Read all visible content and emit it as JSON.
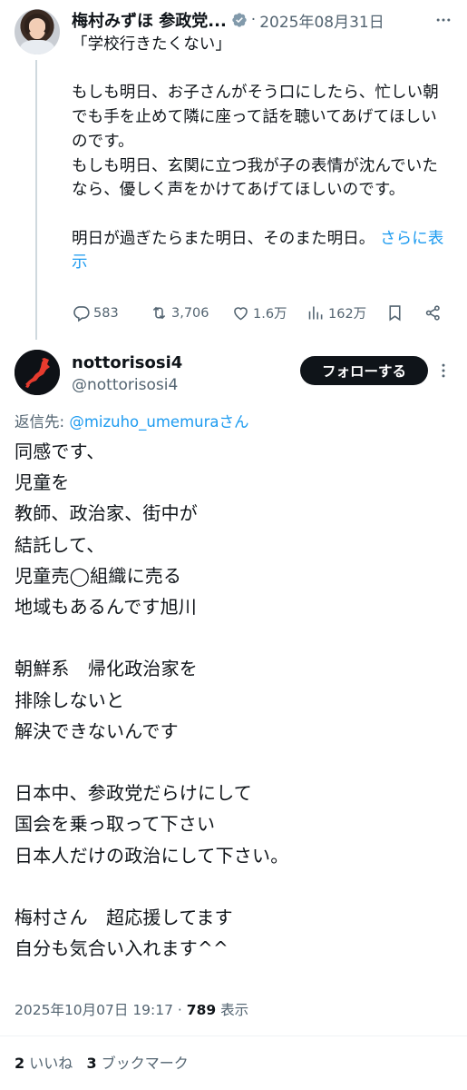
{
  "parent_tweet": {
    "author_name": "梅村みずほ 参政党...",
    "separator": "·",
    "date": "2025年08月31日",
    "text_main": "「学校行きたくない」\n\nもしも明日、お子さんがそう口にしたら、忙しい朝でも手を止めて隣に座って話を聴いてあげてほしいのです。\nもしも明日、玄関に立つ我が子の表情が沈んでいたなら、優しく声をかけてあげてほしいのです。\n\n明日が過ぎたらまた明日、そのまた明日。 ",
    "show_more": "さらに表示",
    "replies": "583",
    "reposts": "3,706",
    "likes": "1.6万",
    "views": "162万",
    "icons": [
      "verified-badge-icon",
      "more-icon",
      "reply-icon",
      "repost-icon",
      "like-icon",
      "views-icon",
      "bookmark-icon",
      "share-icon"
    ]
  },
  "reply_tweet": {
    "author_name": "nottorisosi4",
    "handle": "@nottorisosi4",
    "follow_label": "フォローする",
    "reply_to_prefix": "返信先: ",
    "reply_to_handle": "@mizuho_umemura",
    "reply_to_suffix": "さん",
    "text": "同感です、\n児童を\n教師、政治家、街中が\n結託して、\n児童売◯組織に売る\n地域もあるんです旭川\n\n朝鮮系　帰化政治家を\n排除しないと\n解決できないんです\n\n日本中、参政党だらけにして\n国会を乗っ取って下さい\n日本人だけの政治にして下さい。\n\n梅村さん　超応援してます\n自分も気合い入れます^^",
    "timestamp": "2025年10月07日 19:17",
    "meta_sep": " · ",
    "views_count": "789",
    "views_label": " 表示",
    "likes_count": "2",
    "likes_label": " いいね",
    "bookmarks_count": "3",
    "bookmarks_label": " ブックマーク"
  },
  "colors": {
    "text": "#0f1419",
    "secondary": "#536471",
    "link": "#1d9bf0",
    "verified_badge": "#829aab",
    "divider": "#eff3f4"
  }
}
